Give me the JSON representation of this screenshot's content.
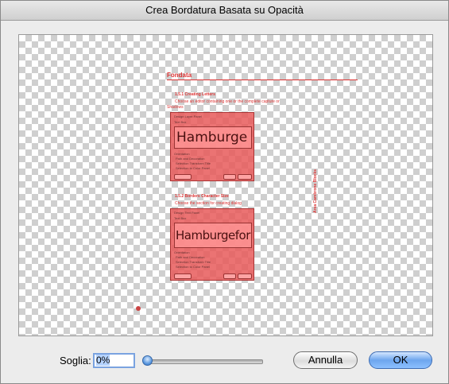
{
  "window": {
    "title": "Crea Bordatura Basata su Opacità"
  },
  "preview": {
    "heading": "Fondata",
    "section1": {
      "title": "1.5.1 Creating Letters",
      "text_line1": "Choose an editor containing one or the complete capture or",
      "text_line2": "Shadows"
    },
    "panel1": {
      "title": "Design Layer Panel",
      "subtitle": "Text Box",
      "word": "Hamburge",
      "rows": [
        "Orientation",
        "Path and Decoration",
        "Selection Transform Title",
        "Selection to Color Panel"
      ]
    },
    "section2": {
      "title": "1.5.2 Borders Character Size",
      "text_line1": "Choose the section for creating dialog"
    },
    "panel2": {
      "title": "Design Text Panel",
      "subtitle": "Text Box",
      "word": "Hamburgefor",
      "rows": [
        "Orientation",
        "Path and Decoration",
        "Selection Transform Title",
        "Selection to Color Panel"
      ]
    },
    "side_text": "Area Cambrone Blocks"
  },
  "controls": {
    "threshold_label": "Soglia:",
    "threshold_value": "0%",
    "slider_value_percent": 0,
    "cancel_label": "Annulla",
    "ok_label": "OK"
  },
  "colors": {
    "accent": "#6ea6ee",
    "preview_red": "#d44444"
  }
}
